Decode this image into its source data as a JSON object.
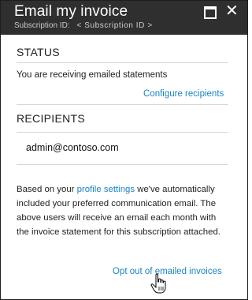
{
  "header": {
    "title": "Email my invoice",
    "subscription_label": "Subscription ID:",
    "subscription_value": "< Subscription ID >",
    "maximize_icon": "maximize-icon",
    "close_icon": "close-icon",
    "close_glyph": "✕"
  },
  "status": {
    "heading": "STATUS",
    "text": "You are receiving emailed statements",
    "configure_link": "Configure recipients"
  },
  "recipients": {
    "heading": "RECIPIENTS",
    "emails": [
      "admin@contoso.com"
    ]
  },
  "info": {
    "line1_before": "Based on your ",
    "line1_link": "profile settings",
    "line1_after": " we've automatically",
    "rest": "included your preferred communication email. The above users will receive an email each month with the invoice statement for this subscription attached."
  },
  "actions": {
    "optout_link": "Opt out of emailed invoices"
  },
  "colors": {
    "header_bg": "#2f2f2f",
    "link": "#1a84c4"
  }
}
